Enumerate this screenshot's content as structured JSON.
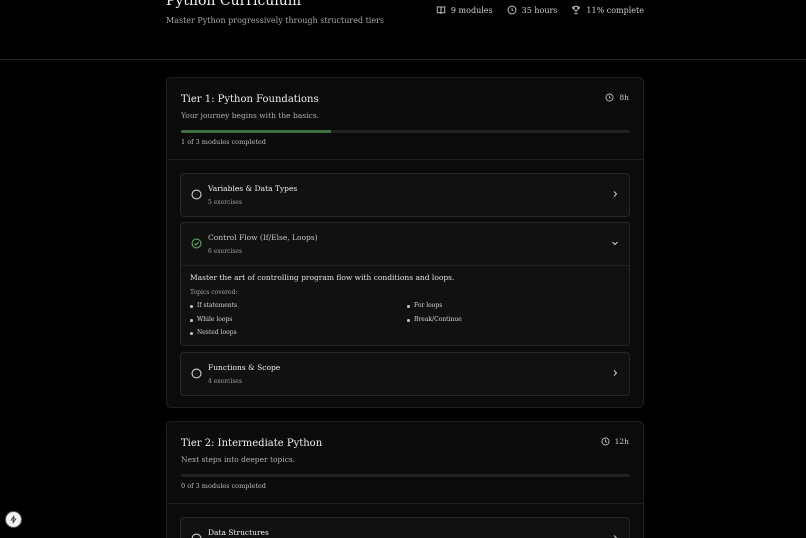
{
  "header": {
    "title": "Python Curriculum",
    "subtitle": "Master Python progressively through structured tiers",
    "stats": {
      "modules": "9 modules",
      "hours": "35 hours",
      "complete": "11% complete"
    }
  },
  "tiers": [
    {
      "title": "Tier 1: Python Foundations",
      "description": "Your journey begins with the basics.",
      "duration": "8h",
      "progress": 0.333,
      "progress_text": "1 of 3 modules completed",
      "modules": [
        {
          "title": "Variables & Data Types",
          "subtitle": "5 exercises",
          "completed": false,
          "expanded": false
        },
        {
          "title": "Control Flow (If/Else, Loops)",
          "subtitle": "6 exercises",
          "completed": true,
          "expanded": true,
          "description": "Master the art of controlling program flow with conditions and loops.",
          "topics_label": "Topics covered:",
          "topics": [
            "If statements",
            "For loops",
            "While loops",
            "Break/Continue",
            "Nested loops"
          ]
        },
        {
          "title": "Functions & Scope",
          "subtitle": "4 exercises",
          "completed": false,
          "expanded": false
        }
      ]
    },
    {
      "title": "Tier 2: Intermediate Python",
      "description": "Next steps into deeper topics.",
      "duration": "12h",
      "progress": 0,
      "progress_text": "0 of 3 modules completed",
      "modules": [
        {
          "title": "Data Structures",
          "subtitle": "",
          "completed": false,
          "expanded": false
        }
      ]
    }
  ],
  "colors": {
    "background": "#000000",
    "card": "#0b0b0b",
    "module": "#111111",
    "progress": "#3f6f3f",
    "check": "#5fa85f"
  },
  "icons": {
    "modules": "book-icon",
    "hours": "clock-icon",
    "complete": "trophy-icon",
    "duration": "clock-icon",
    "incomplete": "circle-icon",
    "completed": "check-circle-icon",
    "collapsed": "chevron-right-icon",
    "expanded": "chevron-down-icon",
    "fab": "spark-icon"
  }
}
